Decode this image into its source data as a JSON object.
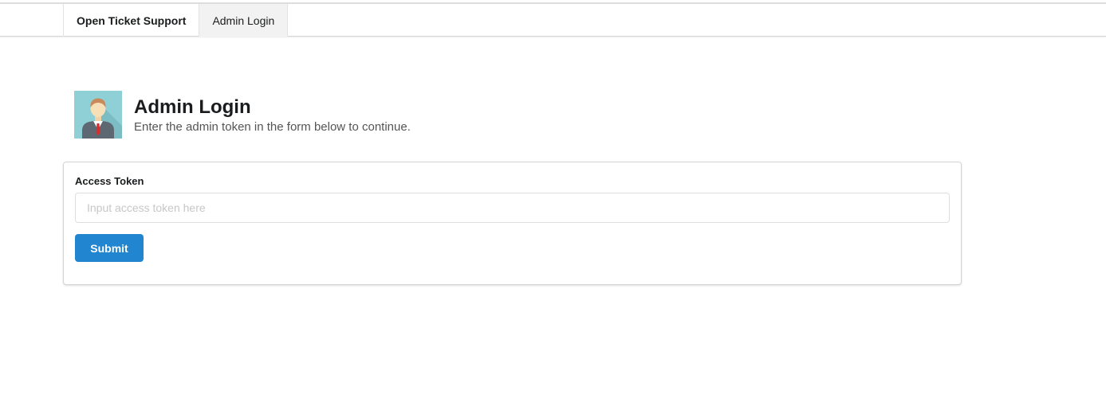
{
  "nav": {
    "brand": "Open Ticket Support",
    "items": [
      {
        "label": "Admin Login",
        "active": true
      }
    ]
  },
  "header": {
    "title": "Admin Login",
    "subtitle": "Enter the admin token in the form below to continue.",
    "avatar_icon": "admin-avatar-icon"
  },
  "form": {
    "label": "Access Token",
    "placeholder": "Input access token here",
    "value": "",
    "submit_label": "Submit"
  },
  "colors": {
    "primary": "#2185d0",
    "avatar_bg": "#8fcfd6"
  }
}
